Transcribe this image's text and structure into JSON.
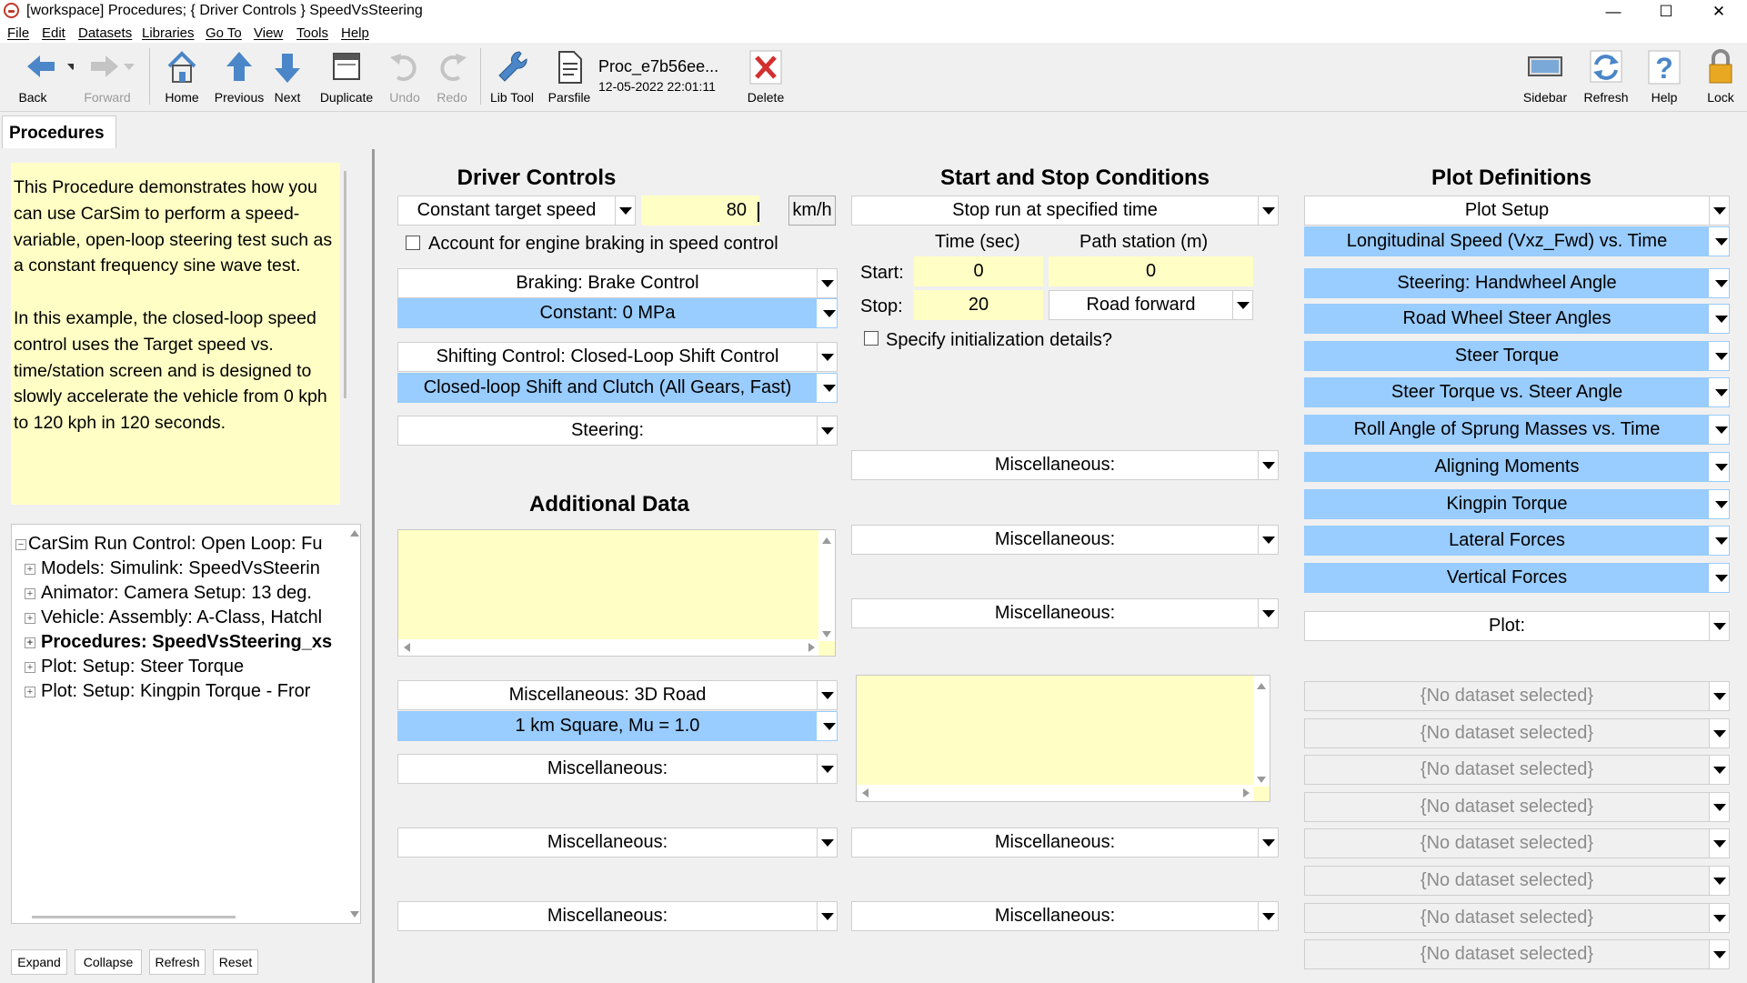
{
  "window": {
    "title": "[workspace] Procedures; { Driver Controls } SpeedVsSteering",
    "controls": [
      "—",
      "☐",
      "✕"
    ]
  },
  "menu": [
    "File",
    "Edit",
    "Datasets",
    "Libraries",
    "Go To",
    "View",
    "Tools",
    "Help"
  ],
  "toolbar": {
    "back": "Back",
    "forward": "Forward",
    "home": "Home",
    "previous": "Previous",
    "next": "Next",
    "duplicate": "Duplicate",
    "undo": "Undo",
    "redo": "Redo",
    "lib_tool": "Lib Tool",
    "parsfile": "Parsfile",
    "dataset_name": "Proc_e7b56ee...",
    "dataset_date": "12-05-2022 22:01:11",
    "delete": "Delete",
    "sidebar": "Sidebar",
    "refresh": "Refresh",
    "help": "Help",
    "lock": "Lock"
  },
  "tab": "Procedures",
  "left": {
    "description": "This Procedure demonstrates how you can use CarSim to perform a speed-variable, open-loop steering test such as a constant frequency sine wave test.\n\nIn this example, the closed-loop speed control uses the Target speed vs. time/station screen and is designed to slowly accelerate the vehicle from 0 kph to 120 kph in 120 seconds.",
    "tree": [
      "CarSim Run Control: Open Loop: Fu",
      "Models: Simulink: SpeedVsSteerin",
      "Animator: Camera Setup: 13 deg.",
      "Vehicle: Assembly: A-Class, Hatchl",
      "Procedures: SpeedVsSteering_xs",
      "Plot: Setup: Steer Torque",
      "Plot: Setup: Kingpin Torque - Fror"
    ],
    "buttons": [
      "Expand",
      "Collapse",
      "Refresh",
      "Reset"
    ]
  },
  "driver": {
    "heading": "Driver Controls",
    "speed_mode": "Constant target speed",
    "speed_value": "80",
    "speed_unit": "km/h",
    "engine_braking": "Account for engine braking in speed control",
    "braking": "Braking: Brake Control",
    "braking_dataset": "Constant: 0 MPa",
    "shifting": "Shifting Control: Closed-Loop Shift Control",
    "shifting_dataset": "Closed-loop Shift and Clutch (All Gears, Fast)",
    "steering": "Steering:"
  },
  "additional": {
    "heading": "Additional Data",
    "misc_3d_road": "Miscellaneous: 3D Road",
    "road_dataset": "1 km Square, Mu = 1.0",
    "misc1": "Miscellaneous:",
    "misc2": "Miscellaneous:",
    "misc3": "Miscellaneous:"
  },
  "start_stop": {
    "heading": "Start and Stop Conditions",
    "stop_mode": "Stop run at specified time",
    "time_header": "Time (sec)",
    "station_header": "Path station (m)",
    "start_label": "Start:",
    "start_time": "0",
    "start_station": "0",
    "stop_label": "Stop:",
    "stop_time": "20",
    "stop_direction": "Road forward",
    "init_details": "Specify initialization details?",
    "misc_a": "Miscellaneous:",
    "misc_b": "Miscellaneous:",
    "misc_c": "Miscellaneous:",
    "misc_d": "Miscellaneous:",
    "misc_e": "Miscellaneous:"
  },
  "plots": {
    "heading": "Plot Definitions",
    "setup": "Plot Setup",
    "items": [
      "Longitudinal Speed (Vxz_Fwd) vs. Time",
      "Steering: Handwheel Angle",
      "Road Wheel Steer Angles",
      "Steer Torque",
      "Steer Torque vs. Steer Angle",
      "Roll Angle of Sprung Masses vs. Time",
      "Aligning Moments",
      "Kingpin Torque",
      "Lateral Forces",
      "Vertical Forces"
    ],
    "plot_label": "Plot:",
    "empty": "{No dataset selected}"
  },
  "colors": {
    "selected": "#99ccff",
    "editable": "#ffffc5",
    "delete": "#d32f2f",
    "toolbar_icon": "#4a86c8"
  }
}
